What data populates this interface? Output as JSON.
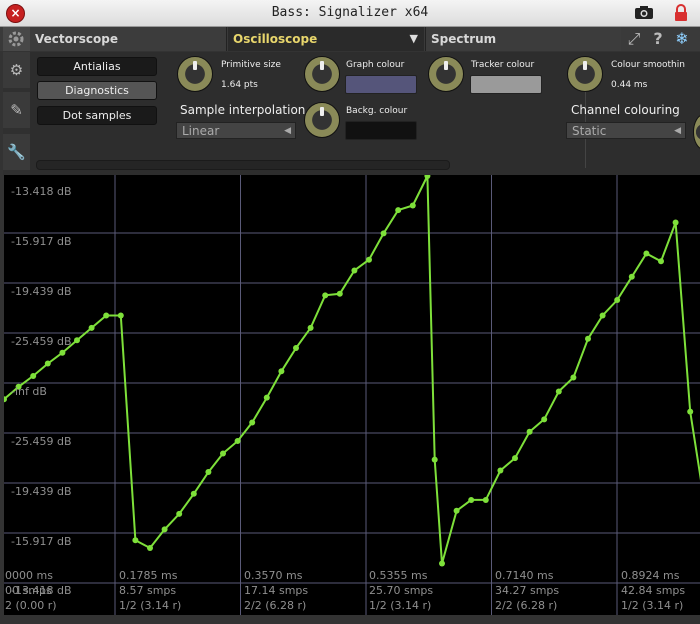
{
  "window": {
    "title": "Bass: Signalizer x64"
  },
  "tabs": [
    {
      "label": "Vectorscope"
    },
    {
      "label": "Oscilloscope",
      "active": true
    },
    {
      "label": "Spectrum"
    }
  ],
  "controls": {
    "antialias": "Antialias",
    "diagnostics": "Diagnostics",
    "dot_samples": "Dot samples",
    "primitive_size_label": "Primitive size",
    "primitive_size_value": "1.64 pts",
    "graph_colour_label": "Graph colour",
    "tracker_colour_label": "Tracker colour",
    "colour_smoothing_label": "Colour smoothin",
    "colour_smoothing_value": "0.44 ms",
    "sample_interpolation_label": "Sample interpolation",
    "sample_interpolation_value": "Linear",
    "backg_colour_label": "Backg. colour",
    "channel_colouring_label": "Channel colouring",
    "channel_colouring_value": "Static"
  },
  "colors": {
    "trace": "#7ee03a",
    "grid": "#5a5a78",
    "graph_swatch": "#55557a",
    "tracker_swatch": "#9a9a9a",
    "background_swatch": "#111111",
    "accent_tab": "#e8d66c"
  },
  "plot": {
    "y_labels": [
      "-13.418 dB",
      "-15.917 dB",
      "-19.439 dB",
      "-25.459 dB",
      "-inf dB",
      "-25.459 dB",
      "-19.439 dB",
      "-15.917 dB",
      "-13.418 dB"
    ],
    "x_labels": [
      [
        "0000 ms",
        "00 smps",
        "2 (0.00 r)"
      ],
      [
        "0.1785 ms",
        "8.57 smps",
        "1/2 (3.14 r)"
      ],
      [
        "0.3570 ms",
        "17.14 smps",
        "2/2 (6.28 r)"
      ],
      [
        "0.5355 ms",
        "25.70 smps",
        "1/2 (3.14 r)"
      ],
      [
        "0.7140 ms",
        "34.27 smps",
        "2/2 (6.28 r)"
      ],
      [
        "0.8924 ms",
        "42.84 smps",
        "1/2 (3.14 r)"
      ]
    ]
  },
  "chart_data": {
    "type": "line",
    "ylim": [
      -1,
      1
    ],
    "x_unit": "samples",
    "series": [
      {
        "points": [
          [
            0,
            -0.04
          ],
          [
            1,
            0.04
          ],
          [
            2,
            0.11
          ],
          [
            3,
            0.19
          ],
          [
            4,
            0.26
          ],
          [
            5,
            0.34
          ],
          [
            6,
            0.42
          ],
          [
            7,
            0.5
          ],
          [
            8,
            0.5
          ],
          [
            9,
            -0.95
          ],
          [
            10,
            -1.0
          ],
          [
            11,
            -0.88
          ],
          [
            12,
            -0.78
          ],
          [
            13,
            -0.65
          ],
          [
            14,
            -0.51
          ],
          [
            15,
            -0.39
          ],
          [
            16,
            -0.31
          ],
          [
            17,
            -0.19
          ],
          [
            18,
            -0.03
          ],
          [
            19,
            0.14
          ],
          [
            20,
            0.29
          ],
          [
            21,
            0.42
          ],
          [
            22,
            0.63
          ],
          [
            23,
            0.64
          ],
          [
            24,
            0.79
          ],
          [
            25,
            0.86
          ],
          [
            26,
            1.03
          ],
          [
            27,
            1.18
          ],
          [
            28,
            1.21
          ],
          [
            29,
            1.4
          ],
          [
            29.5,
            -0.43
          ],
          [
            30,
            -1.1
          ],
          [
            31,
            -0.76
          ],
          [
            32,
            -0.69
          ],
          [
            33,
            -0.69
          ],
          [
            34,
            -0.5
          ],
          [
            35,
            -0.42
          ],
          [
            36,
            -0.25
          ],
          [
            37,
            -0.17
          ],
          [
            38,
            0.01
          ],
          [
            39,
            0.1
          ],
          [
            40,
            0.35
          ],
          [
            41,
            0.5
          ],
          [
            42,
            0.6
          ],
          [
            43,
            0.75
          ],
          [
            44,
            0.9
          ],
          [
            45,
            0.85
          ],
          [
            46,
            1.1
          ],
          [
            47,
            -0.12
          ],
          [
            48,
            -0.72
          ],
          [
            49,
            -0.48
          ],
          [
            50,
            -0.49
          ],
          [
            51,
            -0.37
          ],
          [
            52,
            -0.6
          ]
        ]
      }
    ]
  }
}
